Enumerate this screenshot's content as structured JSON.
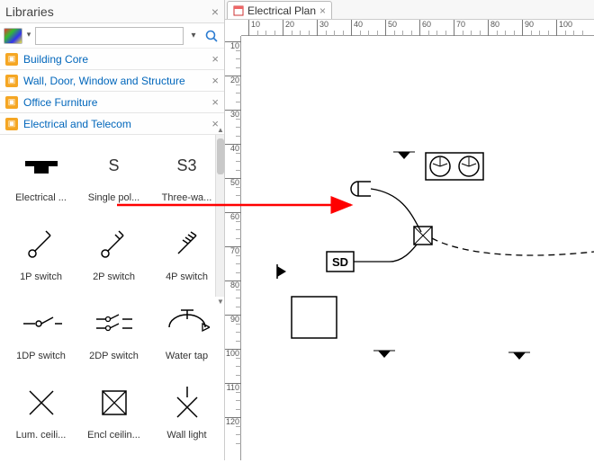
{
  "sidebar": {
    "title": "Libraries",
    "search_placeholder": "",
    "items": [
      {
        "label": "Building Core"
      },
      {
        "label": "Wall, Door, Window and Structure"
      },
      {
        "label": "Office Furniture"
      },
      {
        "label": "Electrical and Telecom"
      }
    ],
    "shapes": [
      {
        "label": "Electrical ...",
        "glyph": "outlet"
      },
      {
        "label": "Single pol...",
        "glyph": "text-S"
      },
      {
        "label": "Three-wa...",
        "glyph": "text-S3"
      },
      {
        "label": "1P switch",
        "glyph": "sw1"
      },
      {
        "label": "2P switch",
        "glyph": "sw2"
      },
      {
        "label": "4P switch",
        "glyph": "sw4"
      },
      {
        "label": "1DP switch",
        "glyph": "dp1"
      },
      {
        "label": "2DP switch",
        "glyph": "dp2"
      },
      {
        "label": "Water tap",
        "glyph": "tap"
      },
      {
        "label": "Lum. ceili...",
        "glyph": "x"
      },
      {
        "label": "Encl ceilin...",
        "glyph": "boxx"
      },
      {
        "label": "Wall light",
        "glyph": "wallx"
      }
    ]
  },
  "tab": {
    "name": "Electrical Plan"
  },
  "ruler_h": [
    10,
    20,
    30,
    40,
    50,
    60,
    70,
    80,
    90,
    100
  ],
  "ruler_v": [
    10,
    20,
    30,
    40,
    50,
    60,
    70,
    80,
    90,
    100,
    110,
    120
  ],
  "canvas": {
    "sd_label": "SD"
  }
}
